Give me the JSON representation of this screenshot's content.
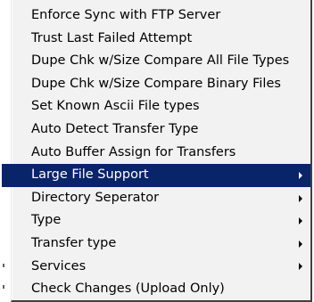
{
  "menu": {
    "items": [
      {
        "label": "Enforce Sync with FTP Server",
        "submenu": false,
        "selected": false
      },
      {
        "label": "Trust Last Failed Attempt",
        "submenu": false,
        "selected": false
      },
      {
        "label": "Dupe Chk w/Size Compare All File Types",
        "submenu": false,
        "selected": false
      },
      {
        "label": "Dupe Chk w/Size Compare Binary Files",
        "submenu": false,
        "selected": false
      },
      {
        "label": "Set Known Ascii File types",
        "submenu": false,
        "selected": false
      },
      {
        "label": "Auto Detect Transfer Type",
        "submenu": false,
        "selected": false
      },
      {
        "label": "Auto Buffer Assign for Transfers",
        "submenu": false,
        "selected": false
      },
      {
        "label": "Large File Support",
        "submenu": true,
        "selected": true
      },
      {
        "label": "Directory Seperator",
        "submenu": true,
        "selected": false
      },
      {
        "label": "Type",
        "submenu": true,
        "selected": false
      },
      {
        "label": "Transfer type",
        "submenu": true,
        "selected": false
      },
      {
        "label": "Services",
        "submenu": true,
        "selected": false
      },
      {
        "label": "Check Changes (Upload Only)",
        "submenu": false,
        "selected": false
      }
    ]
  },
  "colors": {
    "menu_background": "#f2f2f2",
    "highlight": "#0a246a",
    "highlight_text": "#ffffff",
    "text": "#000000"
  },
  "icons": {
    "submenu": "submenu-arrow-icon"
  }
}
